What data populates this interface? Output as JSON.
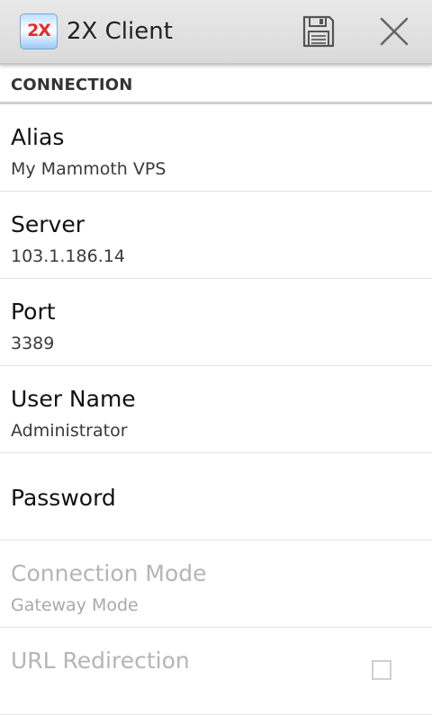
{
  "app": {
    "title": "2X Client",
    "logo_text": "2X"
  },
  "toolbar": {
    "save_icon": "save-icon",
    "close_icon": "close-icon"
  },
  "section": {
    "header": "CONNECTION"
  },
  "preferences": {
    "alias": {
      "title": "Alias",
      "value": "My Mammoth VPS"
    },
    "server": {
      "title": "Server",
      "value": "103.1.186.14"
    },
    "port": {
      "title": "Port",
      "value": "3389"
    },
    "username": {
      "title": "User Name",
      "value": "Administrator"
    },
    "password": {
      "title": "Password"
    },
    "connection_mode": {
      "title": "Connection Mode",
      "value": "Gateway Mode",
      "enabled": false
    },
    "url_redirection": {
      "title": "URL Redirection",
      "checked": false,
      "enabled": false
    }
  },
  "colors": {
    "action_bar": "#dedede",
    "divider": "#cfcfcf",
    "disabled_text": "#b5b5b5",
    "logo_red": "#e32b2b"
  }
}
